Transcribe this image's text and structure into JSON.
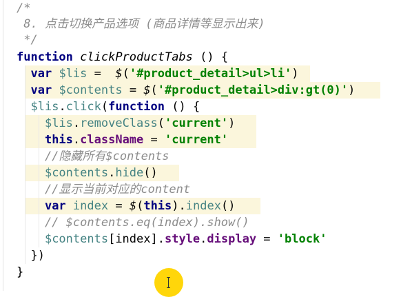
{
  "editor": {
    "lines": [
      {
        "tokens": [
          {
            "t": "/*",
            "c": "comment"
          }
        ]
      },
      {
        "tokens": [
          {
            "t": " 8. 点击切换产品选项 (商品详情等显示出来)",
            "c": "comment"
          }
        ]
      },
      {
        "tokens": [
          {
            "t": " */",
            "c": "comment"
          }
        ]
      },
      {
        "tokens": [
          {
            "t": "function",
            "c": "kw"
          },
          {
            "t": " ",
            "c": "plain"
          },
          {
            "t": "clickProductTabs",
            "c": "fn"
          },
          {
            "t": " () {",
            "c": "plain"
          }
        ]
      },
      {
        "tokens": [
          {
            "t": "  ",
            "c": "plain"
          },
          {
            "t": "var",
            "c": "kw"
          },
          {
            "t": " ",
            "c": "plain"
          },
          {
            "t": "$lis",
            "c": "var"
          },
          {
            "t": " =  ",
            "c": "plain"
          },
          {
            "t": "$",
            "c": "dollar"
          },
          {
            "t": "(",
            "c": "plain"
          },
          {
            "t": "'#product_detail>ul>li'",
            "c": "str"
          },
          {
            "t": ")",
            "c": "plain"
          }
        ]
      },
      {
        "tokens": [
          {
            "t": "  ",
            "c": "plain"
          },
          {
            "t": "var",
            "c": "kw"
          },
          {
            "t": " ",
            "c": "plain"
          },
          {
            "t": "$contents",
            "c": "var"
          },
          {
            "t": " = ",
            "c": "plain"
          },
          {
            "t": "$",
            "c": "dollar"
          },
          {
            "t": "(",
            "c": "plain"
          },
          {
            "t": "'#product_detail>div:gt(0)'",
            "c": "str"
          },
          {
            "t": ")",
            "c": "plain"
          }
        ]
      },
      {
        "tokens": [
          {
            "t": "  ",
            "c": "plain"
          },
          {
            "t": "$lis",
            "c": "var"
          },
          {
            "t": ".",
            "c": "plain"
          },
          {
            "t": "click",
            "c": "var"
          },
          {
            "t": "(",
            "c": "plain"
          },
          {
            "t": "function",
            "c": "kw"
          },
          {
            "t": " () {",
            "c": "plain"
          }
        ]
      },
      {
        "tokens": [
          {
            "t": "    ",
            "c": "plain"
          },
          {
            "t": "$lis",
            "c": "var"
          },
          {
            "t": ".",
            "c": "plain"
          },
          {
            "t": "removeClass",
            "c": "var"
          },
          {
            "t": "(",
            "c": "plain"
          },
          {
            "t": "'current'",
            "c": "str"
          },
          {
            "t": ")",
            "c": "plain"
          }
        ]
      },
      {
        "tokens": [
          {
            "t": "    ",
            "c": "plain"
          },
          {
            "t": "this",
            "c": "kw"
          },
          {
            "t": ".",
            "c": "plain"
          },
          {
            "t": "className",
            "c": "prop"
          },
          {
            "t": " = ",
            "c": "plain"
          },
          {
            "t": "'current'",
            "c": "str"
          }
        ]
      },
      {
        "tokens": [
          {
            "t": "    //隐藏所有$contents",
            "c": "comment"
          }
        ]
      },
      {
        "tokens": [
          {
            "t": "    ",
            "c": "plain"
          },
          {
            "t": "$contents",
            "c": "var"
          },
          {
            "t": ".",
            "c": "plain"
          },
          {
            "t": "hide",
            "c": "var"
          },
          {
            "t": "()",
            "c": "plain"
          }
        ]
      },
      {
        "tokens": [
          {
            "t": "    //显示当前对应的content",
            "c": "comment"
          }
        ]
      },
      {
        "tokens": [
          {
            "t": "    ",
            "c": "plain"
          },
          {
            "t": "var",
            "c": "kw"
          },
          {
            "t": " ",
            "c": "plain"
          },
          {
            "t": "index",
            "c": "var"
          },
          {
            "t": " = ",
            "c": "plain"
          },
          {
            "t": "$",
            "c": "dollar"
          },
          {
            "t": "(",
            "c": "plain"
          },
          {
            "t": "this",
            "c": "kw"
          },
          {
            "t": ").",
            "c": "plain"
          },
          {
            "t": "index",
            "c": "var"
          },
          {
            "t": "()",
            "c": "plain"
          }
        ]
      },
      {
        "tokens": [
          {
            "t": "    // $contents.eq(index).show()",
            "c": "comment"
          }
        ]
      },
      {
        "tokens": [
          {
            "t": "    ",
            "c": "plain"
          },
          {
            "t": "$contents",
            "c": "var"
          },
          {
            "t": "[index].",
            "c": "plain"
          },
          {
            "t": "style",
            "c": "prop"
          },
          {
            "t": ".",
            "c": "plain"
          },
          {
            "t": "display",
            "c": "prop"
          },
          {
            "t": " = ",
            "c": "plain"
          },
          {
            "t": "'block'",
            "c": "str"
          }
        ]
      },
      {
        "tokens": [
          {
            "t": "  })",
            "c": "plain"
          }
        ]
      },
      {
        "tokens": [
          {
            "t": "}",
            "c": "plain"
          }
        ]
      }
    ],
    "colors": {
      "comment": "#8c8c8c",
      "keyword": "#000080",
      "variable": "#458383",
      "string": "#008000",
      "property": "#660e7a",
      "highlight": "#fbf6dc",
      "cursor_highlight": "#ffd60a"
    }
  },
  "cursor": {
    "icon": "text-cursor-icon"
  }
}
